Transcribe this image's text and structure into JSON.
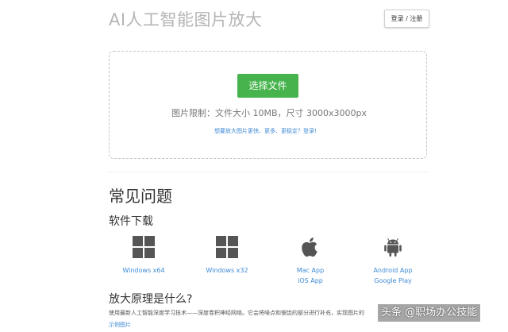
{
  "header": {
    "site_title": "AI人工智能图片放大",
    "login_label": "登录 / 注册"
  },
  "upload": {
    "choose_label": "选择文件",
    "limit_text": "图片限制：文件大小 10MB，尺寸 3000x3000px",
    "upgrade_link": "想要放大图片更快、更多、更稳定？登录!"
  },
  "faq": {
    "title": "常见问题",
    "download_title": "软件下载",
    "downloads": [
      {
        "icon": "windows-icon",
        "label1": "Windows x64",
        "label2": ""
      },
      {
        "icon": "windows-icon",
        "label1": "Windows x32",
        "label2": ""
      },
      {
        "icon": "apple-icon",
        "label1": "Mac App",
        "label2": "iOS App"
      },
      {
        "icon": "android-icon",
        "label1": "Android App",
        "label2": "Google Play"
      }
    ],
    "principle_title": "放大原理是什么?",
    "principle_text": "使用最新人工智能深度学习技术——深度卷积神经网络。它会将噪点和锯齿的部分进行补充，实现图片的",
    "example_link": "示例图片"
  },
  "watermark": "头条 @职场办公技能",
  "colors": {
    "accent_green": "#46b34d",
    "link_blue": "#3d8ad6",
    "title_gray": "#b5b5b5",
    "icon_gray": "#555555"
  }
}
